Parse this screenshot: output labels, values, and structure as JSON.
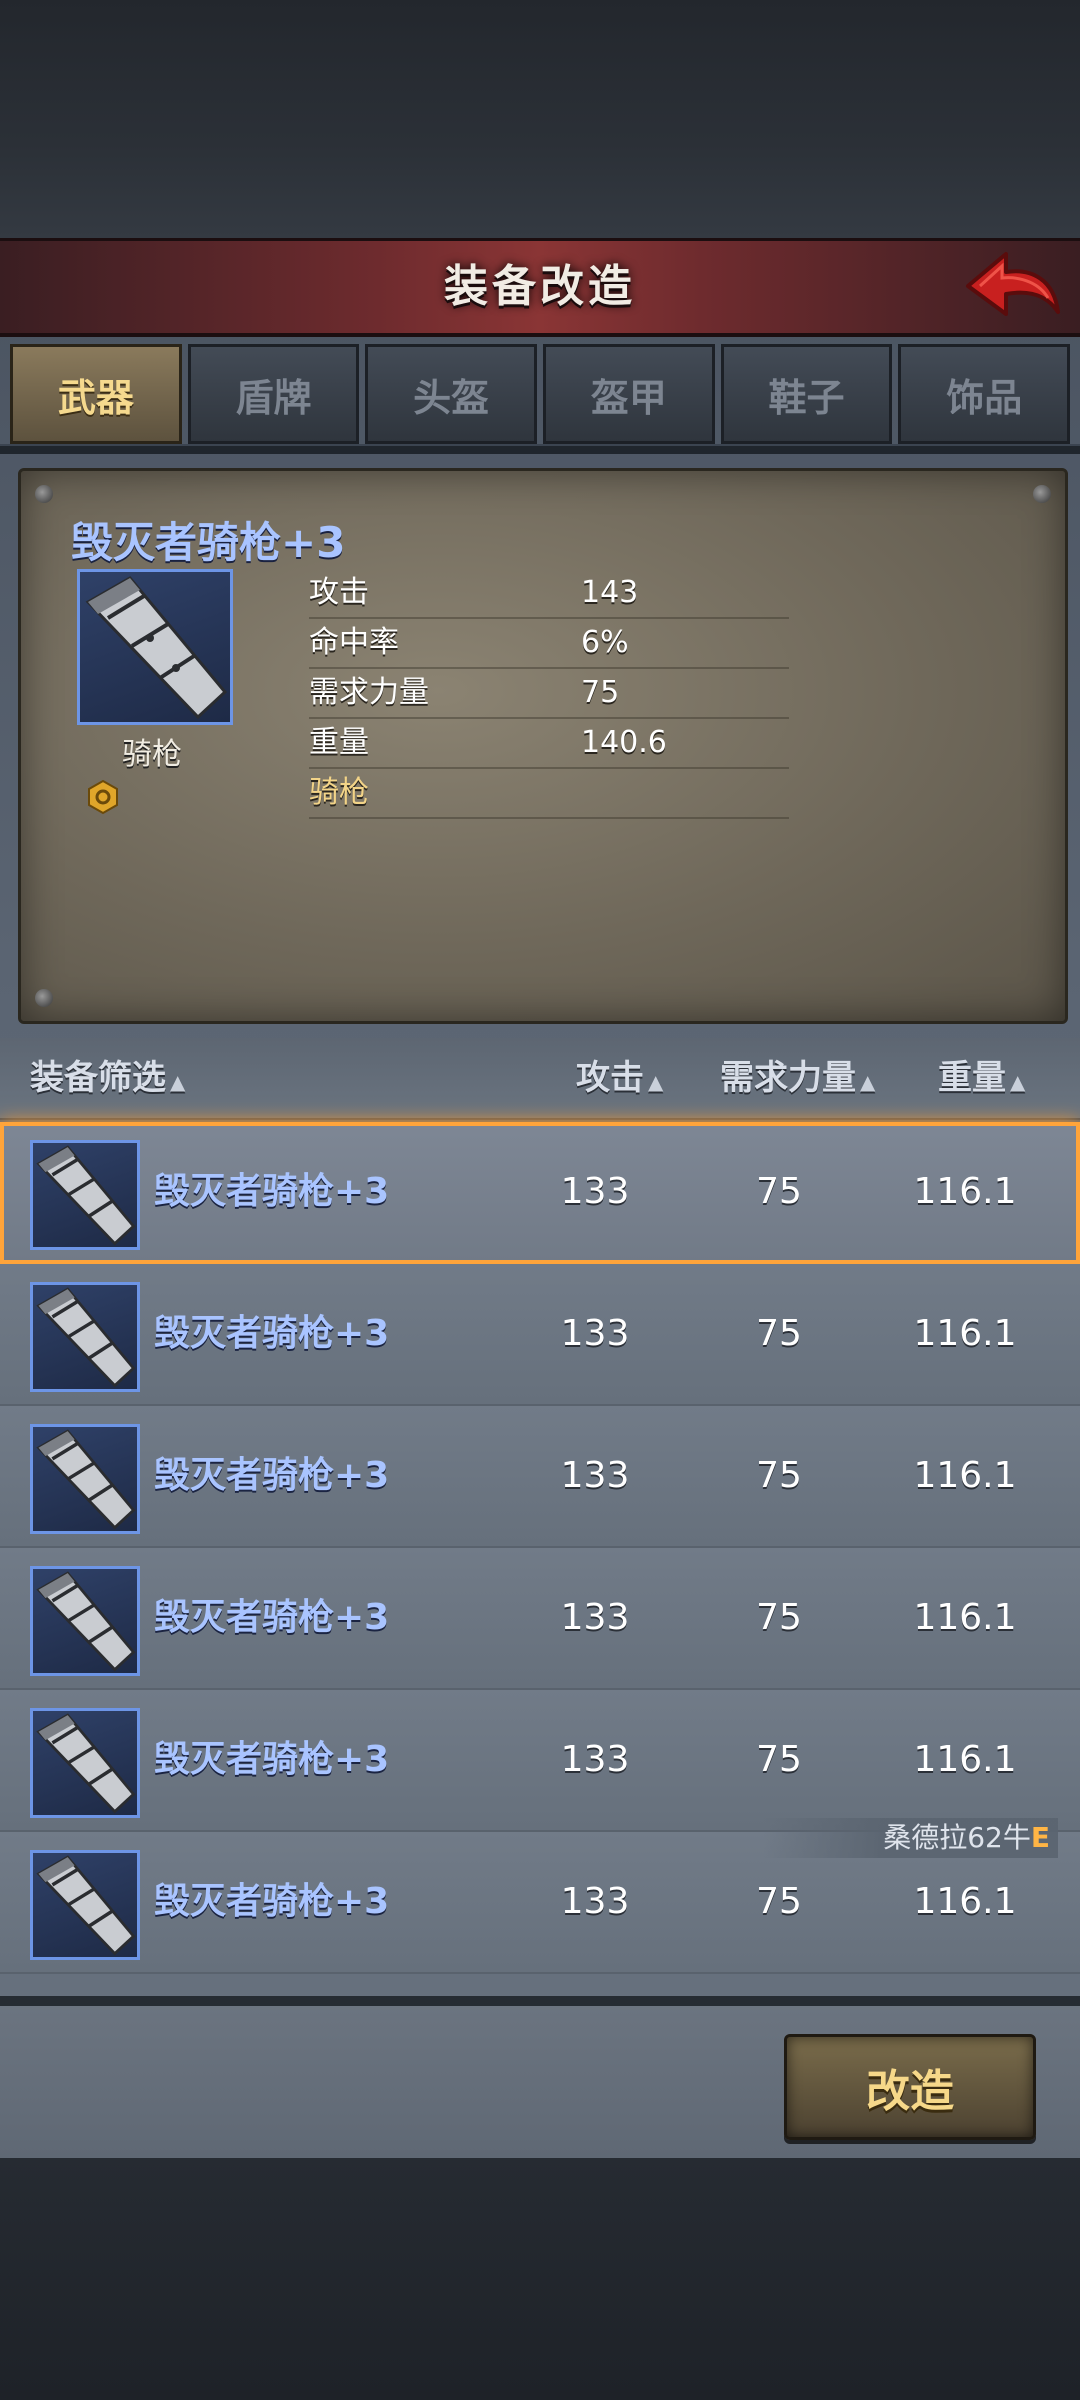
{
  "header": {
    "title": "装备改造",
    "back_icon": "red-back-arrow-icon",
    "accent": "#8a3535"
  },
  "tabs": [
    {
      "label": "武器",
      "active": true
    },
    {
      "label": "盾牌",
      "active": false
    },
    {
      "label": "头盔",
      "active": false
    },
    {
      "label": "盔甲",
      "active": false
    },
    {
      "label": "鞋子",
      "active": false
    },
    {
      "label": "饰品",
      "active": false
    }
  ],
  "detail": {
    "name": "毁灭者骑枪+3",
    "type_label": "骑枪",
    "stats": [
      {
        "label": "攻击",
        "value": "143"
      },
      {
        "label": "命中率",
        "value": "6%"
      },
      {
        "label": "需求力量",
        "value": "75"
      },
      {
        "label": "重量",
        "value": "140.6"
      }
    ],
    "trait": "骑枪"
  },
  "list": {
    "headers": {
      "filter": "装备筛选",
      "attack": "攻击",
      "strength": "需求力量",
      "weight": "重量"
    },
    "rows": [
      {
        "name": "毁灭者骑枪+3",
        "attack": "133",
        "strength": "75",
        "weight": "116.1",
        "selected": true
      },
      {
        "name": "毁灭者骑枪+3",
        "attack": "133",
        "strength": "75",
        "weight": "116.1"
      },
      {
        "name": "毁灭者骑枪+3",
        "attack": "133",
        "strength": "75",
        "weight": "116.1"
      },
      {
        "name": "毁灭者骑枪+3",
        "attack": "133",
        "strength": "75",
        "weight": "116.1"
      },
      {
        "name": "毁灭者骑枪+3",
        "attack": "133",
        "strength": "75",
        "weight": "116.1"
      },
      {
        "name": "毁灭者骑枪+3",
        "attack": "133",
        "strength": "75",
        "weight": "116.1"
      }
    ],
    "equipped_tag": {
      "owner": "桑德拉62牛",
      "grade": "E"
    },
    "selected_color": "#ffa43a"
  },
  "footer": {
    "modify_label": "改造"
  }
}
